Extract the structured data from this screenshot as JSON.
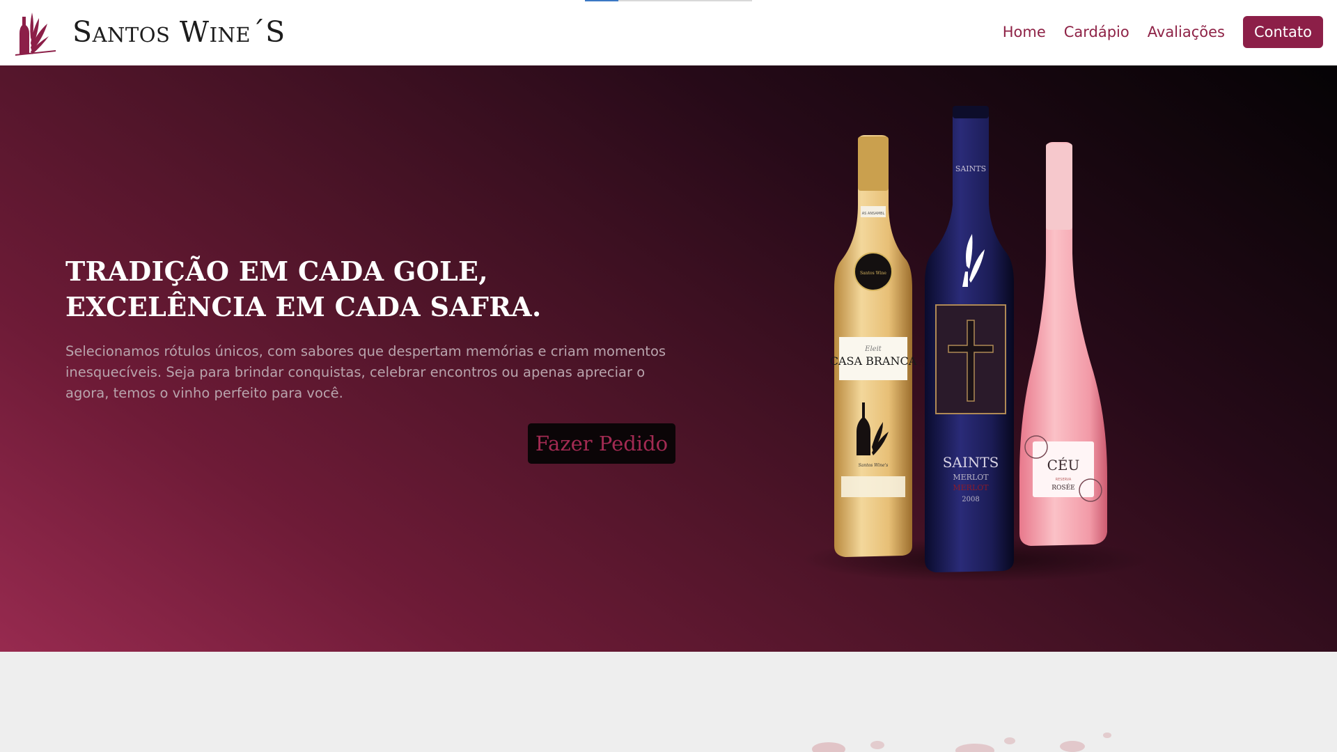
{
  "brand": {
    "name": "Santos Wine´S",
    "logo_icon": "wine-bottle-leaf-logo",
    "accent_color": "#8c1f48"
  },
  "nav": {
    "links": [
      "Home",
      "Cardápio",
      "Avaliações"
    ],
    "cta": "Contato"
  },
  "hero": {
    "title": "Tradição em cada gole, excelência em cada safra.",
    "text": "Selecionamos rótulos únicos, com sabores que despertam memórias e criam momentos inesquecíveis. Seja para brindar conquistas, celebrar encontros ou apenas apreciar o agora, temos o vinho perfeito para você.",
    "button": "Fazer Pedido"
  },
  "bottles": {
    "white": {
      "small": "Eleit",
      "brand": "CASA BRANCA",
      "foot": "Santos Wine's",
      "seal": "Santos Wine",
      "neck": "AS ANSAMBL"
    },
    "red": {
      "neck": "SAINTS",
      "name": "SAINTS",
      "variety": "MERLOT",
      "variety2": "MERLOT",
      "year": "2008"
    },
    "rose": {
      "name": "CÉU",
      "small": "RESERVA",
      "type": "ROSÉE"
    }
  }
}
